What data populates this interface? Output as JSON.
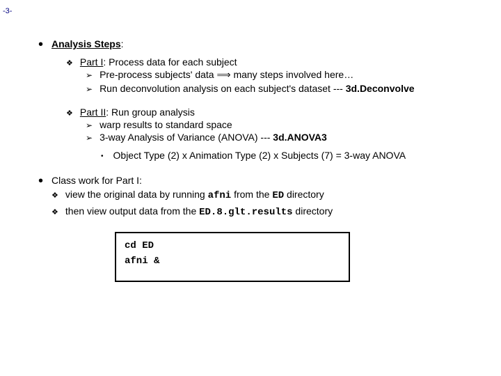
{
  "pageNumber": "-3-",
  "h1": "Analysis Steps",
  "colon": ":",
  "part1": {
    "label": "Part I",
    "rest": ": Process data for each subject",
    "a1_pre": "Pre-process subjects' data ",
    "a1_post": " many steps involved here…",
    "a2_pre": "Run deconvolution analysis on each subject's dataset --- ",
    "a2_bold": "3d.Deconvolve"
  },
  "part2": {
    "label": "Part II",
    "rest": ": Run group analysis",
    "a1": "warp results to standard space",
    "a2_pre": "3-way Analysis of Variance (ANOVA) --- ",
    "a2_bold": "3d.ANOVA3",
    "inner": "Object Type (2) x Animation Type (2) x Subjects (7) = 3-way ANOVA"
  },
  "classwork": {
    "lead": "Class work for Part I:",
    "l1_pre": "view the original data by running ",
    "l1_code1": "afni",
    "l1_mid": " from the ",
    "l1_code2": "ED",
    "l1_post": " directory",
    "l2_pre": "then view output data from the ",
    "l2_code": "ED.8.glt.results",
    "l2_post": " directory"
  },
  "code": {
    "line1": "cd ED",
    "line2": "afni &"
  }
}
